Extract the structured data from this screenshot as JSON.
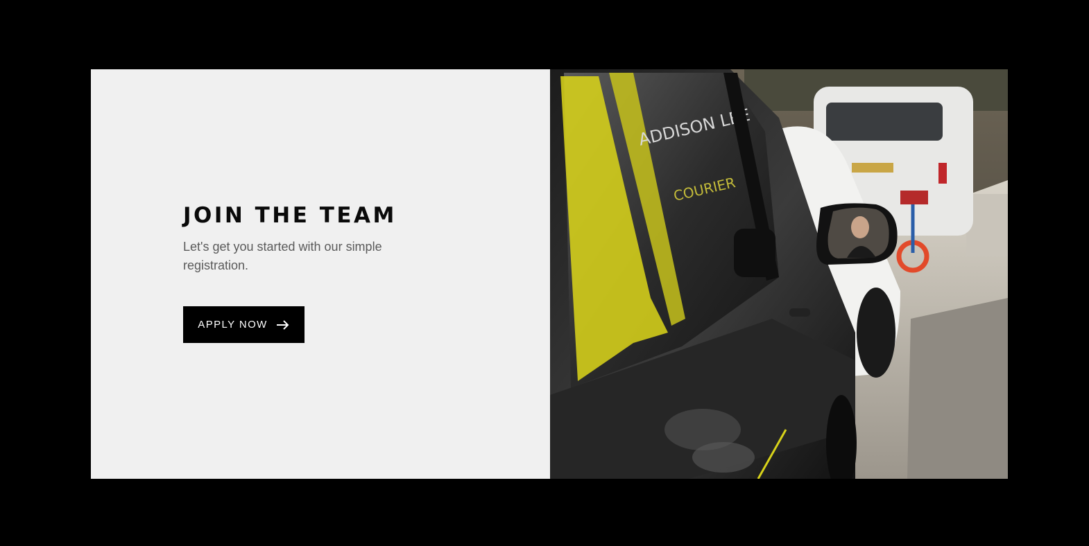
{
  "hero": {
    "title": "JOIN THE TEAM",
    "subtitle": "Let's get you started with our simple registration.",
    "cta_label": "APPLY NOW",
    "cta_icon": "arrow-right-icon",
    "panel_background": "#f0f0f0",
    "button_color": "#000000"
  },
  "photo": {
    "van_text_brand": "ADDISON LEE",
    "van_text_sub": "COURIER",
    "accent_color": "#d7d21a"
  }
}
